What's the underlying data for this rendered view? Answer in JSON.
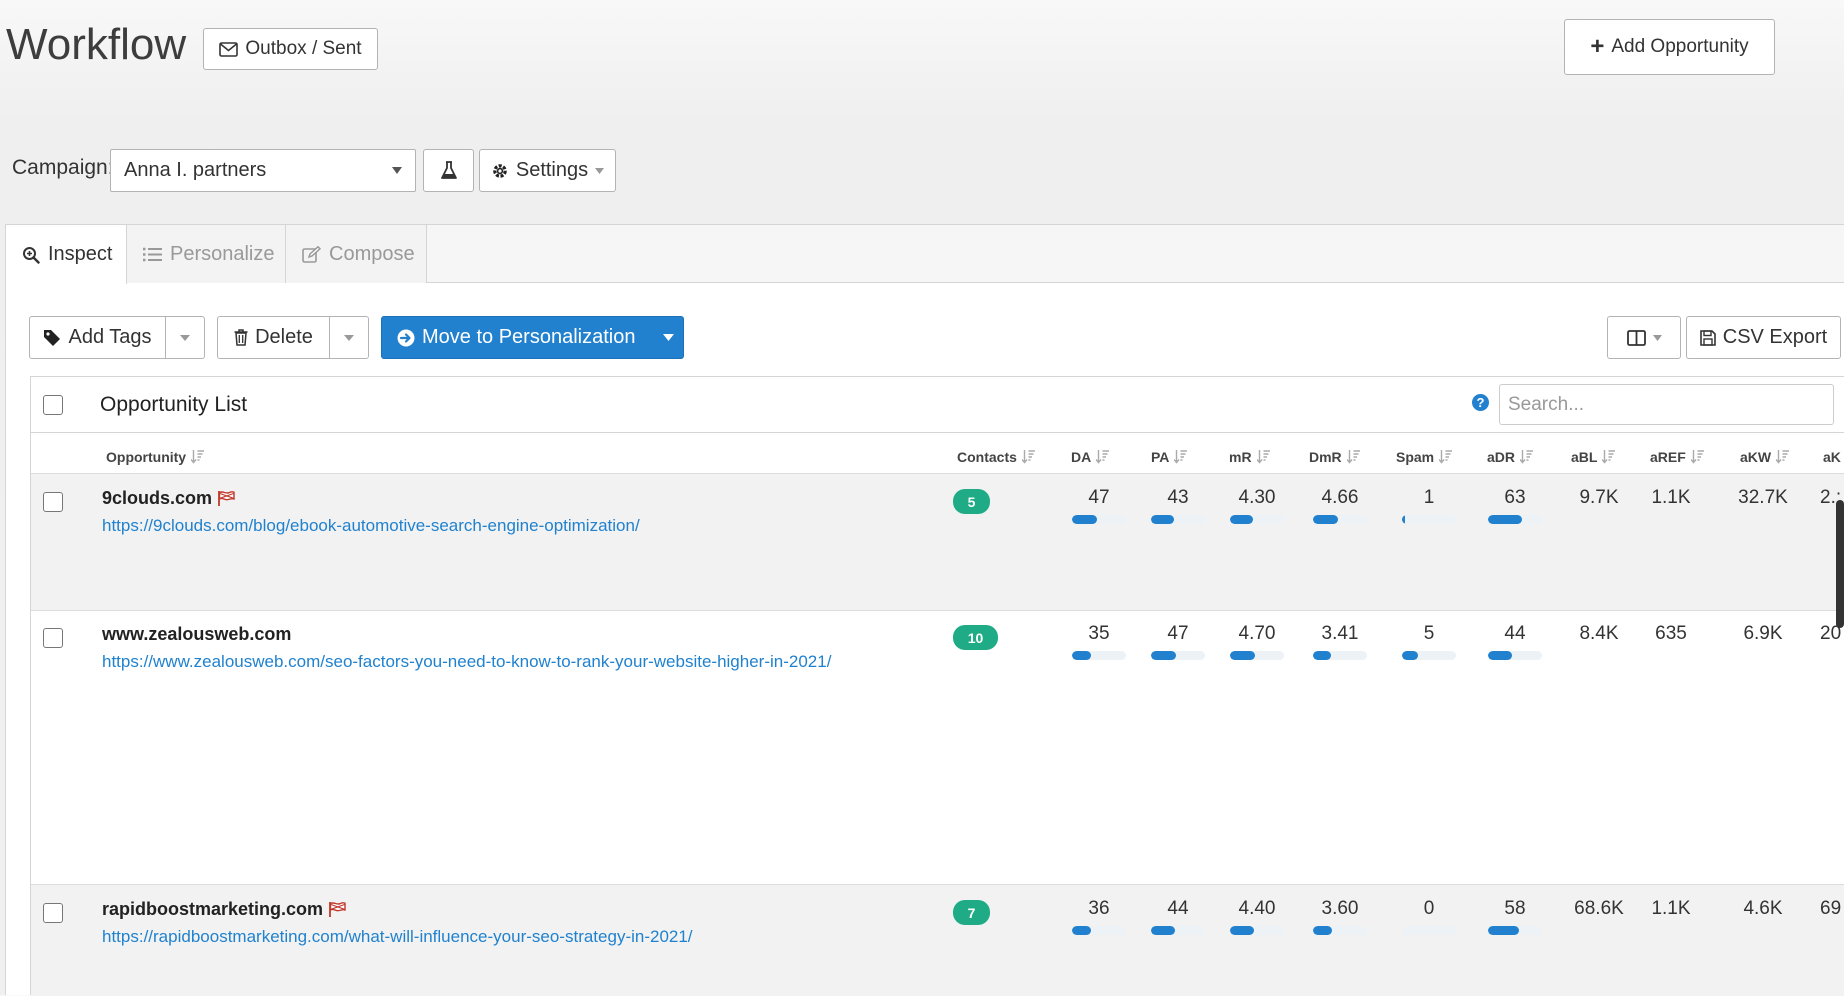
{
  "header": {
    "title": "Workflow",
    "outbox_label": "Outbox / Sent",
    "add_opportunity_label": "Add Opportunity"
  },
  "campaign": {
    "label": "Campaign:",
    "selected": "Anna I. partners",
    "settings_label": "Settings"
  },
  "tabs": [
    {
      "label": "Inspect",
      "icon": "search-plus-icon",
      "active": true
    },
    {
      "label": "Personalize",
      "icon": "list-icon",
      "active": false
    },
    {
      "label": "Compose",
      "icon": "edit-icon",
      "active": false
    }
  ],
  "toolbar": {
    "add_tags_label": "Add Tags",
    "delete_label": "Delete",
    "move_label": "Move to Personalization",
    "csv_export_label": "CSV Export"
  },
  "list": {
    "title": "Opportunity List",
    "search_placeholder": "Search..."
  },
  "columns": [
    {
      "key": "opportunity",
      "label": "Opportunity"
    },
    {
      "key": "contacts",
      "label": "Contacts"
    },
    {
      "key": "da",
      "label": "DA"
    },
    {
      "key": "pa",
      "label": "PA"
    },
    {
      "key": "mr",
      "label": "mR"
    },
    {
      "key": "dmr",
      "label": "DmR"
    },
    {
      "key": "spam",
      "label": "Spam"
    },
    {
      "key": "adr",
      "label": "aDR"
    },
    {
      "key": "abl",
      "label": "aBL"
    },
    {
      "key": "aref",
      "label": "aREF"
    },
    {
      "key": "akw",
      "label": "aKW"
    },
    {
      "key": "ak",
      "label": "aK"
    }
  ],
  "rows": [
    {
      "domain": "9clouds.com",
      "flagged": true,
      "url": "https://9clouds.com/blog/ebook-automotive-search-engine-optimization/",
      "contacts": "5",
      "da": "47",
      "da_level": 0.47,
      "pa": "43",
      "pa_level": 0.43,
      "mr": "4.30",
      "mr_level": 0.43,
      "dmr": "4.66",
      "dmr_level": 0.466,
      "spam": "1",
      "spam_level": 0.05,
      "adr": "63",
      "adr_level": 0.63,
      "abl": "9.7K",
      "aref": "1.1K",
      "akw": "32.7K",
      "ak": "2.:"
    },
    {
      "domain": "www.zealousweb.com",
      "flagged": false,
      "url": "https://www.zealousweb.com/seo-factors-you-need-to-know-to-rank-your-website-higher-in-2021/",
      "contacts": "10",
      "da": "35",
      "da_level": 0.35,
      "pa": "47",
      "pa_level": 0.47,
      "mr": "4.70",
      "mr_level": 0.47,
      "dmr": "3.41",
      "dmr_level": 0.341,
      "spam": "5",
      "spam_level": 0.3,
      "adr": "44",
      "adr_level": 0.44,
      "abl": "8.4K",
      "aref": "635",
      "akw": "6.9K",
      "ak": "20"
    },
    {
      "domain": "rapidboostmarketing.com",
      "flagged": true,
      "url": "https://rapidboostmarketing.com/what-will-influence-your-seo-strategy-in-2021/",
      "contacts": "7",
      "da": "36",
      "da_level": 0.36,
      "pa": "44",
      "pa_level": 0.44,
      "mr": "4.40",
      "mr_level": 0.44,
      "dmr": "3.60",
      "dmr_level": 0.36,
      "spam": "0",
      "spam_level": 0.0,
      "adr": "58",
      "adr_level": 0.58,
      "abl": "68.6K",
      "aref": "1.1K",
      "akw": "4.6K",
      "ak": "69"
    }
  ],
  "colors": {
    "primary": "#2181cf",
    "badge": "#1eab85",
    "link": "#2082cf",
    "flag": "#c0392b"
  }
}
